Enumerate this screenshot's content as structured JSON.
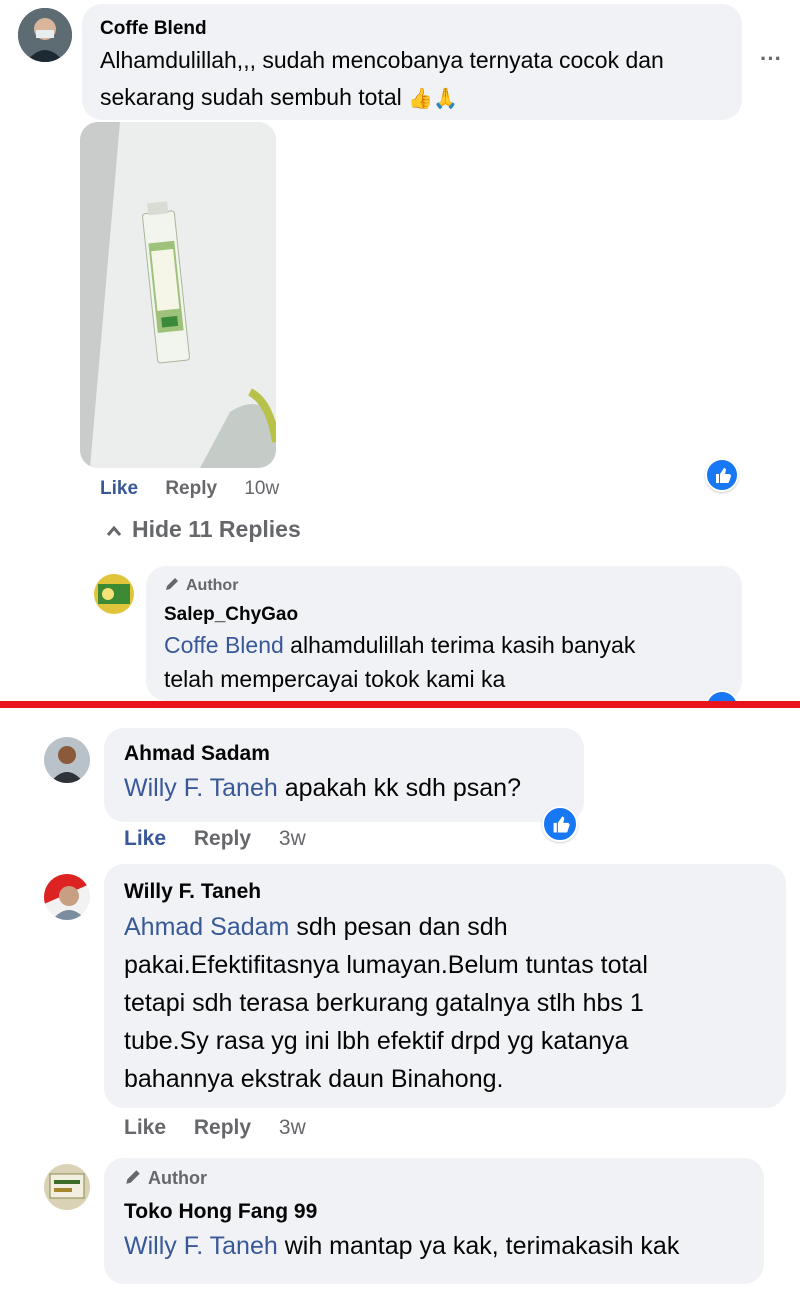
{
  "comments": [
    {
      "name": "Coffe Blend",
      "text_lines": [
        "Alhamdulillah,,, sudah mencobanya ternyata cocok dan",
        "sekarang sudah sembuh total"
      ],
      "emoji": "👍🙏",
      "actions": {
        "like": "Like",
        "reply": "Reply",
        "time": "10w"
      },
      "more": "···"
    },
    {
      "author_tag": "Author",
      "name": "Salep_ChyGao",
      "mention": "Coffe Blend",
      "text_lines": [
        " alhamdulillah terima kasih banyak",
        "telah mempercayai tokok kami ka"
      ]
    },
    {
      "name": "Ahmad Sadam",
      "mention": "Willy F. Taneh",
      "text_lines": [
        " apakah kk sdh psan?"
      ],
      "actions": {
        "like": "Like",
        "reply": "Reply",
        "time": "3w"
      }
    },
    {
      "name": "Willy F. Taneh",
      "mention": "Ahmad Sadam",
      "text_lines": [
        " sdh pesan dan sdh",
        "pakai.Efektifitasnya lumayan.Belum tuntas total",
        "tetapi sdh terasa berkurang gatalnya stlh hbs 1",
        "tube.Sy rasa yg ini lbh efektif drpd yg katanya",
        "bahannya ekstrak daun Binahong."
      ],
      "actions": {
        "like": "Like",
        "reply": "Reply",
        "time": "3w"
      }
    },
    {
      "author_tag": "Author",
      "name": "Toko Hong Fang 99",
      "mention": "Willy F. Taneh",
      "text_lines": [
        " wih mantap ya kak, terimakasih kak"
      ]
    }
  ],
  "hide_replies": "Hide 11 Replies",
  "colors": {
    "accent": "#1877f2",
    "mention": "#385898",
    "divider": "#e8131b",
    "bubble": "#f0f2f5"
  }
}
